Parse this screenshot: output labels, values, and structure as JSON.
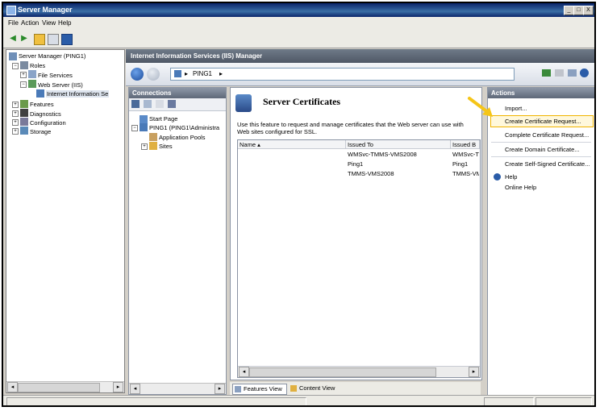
{
  "window": {
    "title": "Server Manager",
    "controls": [
      "_",
      "□",
      "X"
    ]
  },
  "menu": [
    "File",
    "Action",
    "View",
    "Help"
  ],
  "tree": {
    "root": "Server Manager (PING1)",
    "roles": "Roles",
    "file_services": "File Services",
    "web_server": "Web Server (IIS)",
    "iis": "Internet Information Se",
    "features": "Features",
    "diagnostics": "Diagnostics",
    "configuration": "Configuration",
    "storage": "Storage"
  },
  "iis": {
    "header": "Internet Information Services (IIS) Manager",
    "address": "PING1",
    "address_sep": "▸"
  },
  "connections": {
    "title": "Connections",
    "start_page": "Start Page",
    "server": "PING1 (PING1\\Administra",
    "app_pools": "Application Pools",
    "sites": "Sites"
  },
  "feature": {
    "title": "Server Certificates",
    "description": "Use this feature to request and manage certificates that the Web server can use with Web sites configured for SSL.",
    "columns": [
      "Name",
      "Issued To",
      "Issued B"
    ],
    "rows": [
      {
        "name": "",
        "issued_to": "WMSvc-TMMS-VMS2008",
        "issued_by": "WMSvc-T"
      },
      {
        "name": "",
        "issued_to": "Ping1",
        "issued_by": "Ping1"
      },
      {
        "name": "",
        "issued_to": "TMMS-VMS2008",
        "issued_by": "TMMS-VM"
      }
    ],
    "features_view": "Features View",
    "content_view": "Content View"
  },
  "actions": {
    "title": "Actions",
    "import": "Import...",
    "create_request": "Create Certificate Request...",
    "complete_request": "Complete Certificate Request...",
    "create_domain": "Create Domain Certificate...",
    "create_self_signed": "Create Self-Signed Certificate...",
    "help": "Help",
    "online_help": "Online Help"
  },
  "colors": {
    "highlight_border": "#f0b400",
    "arrow": "#f5c518"
  }
}
